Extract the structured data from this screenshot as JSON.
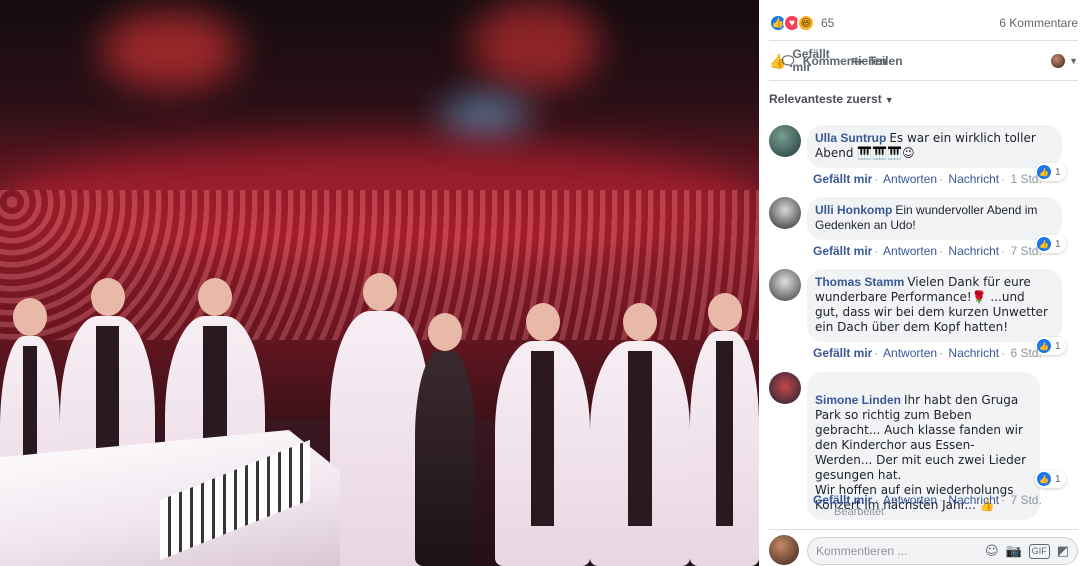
{
  "photo": {
    "alt_icon": "concert-photo"
  },
  "reactions": {
    "count": "65",
    "comments": "6 Kommentare",
    "colors": {
      "like": "#1877f2",
      "love": "#f33e58",
      "haha": "#f7b125"
    }
  },
  "actions": {
    "like": "Gefällt mir",
    "comment": "Kommentieren",
    "share": "Teilen"
  },
  "sort_label": "Relevanteste zuerst",
  "comments": [
    {
      "author": "Ulla Suntrup",
      "text": "Es war ein wirklich toller Abend 🎹🎹🎹😉",
      "likes": "1",
      "time": "1 Std."
    },
    {
      "author": "Ulli Honkomp",
      "text": "Ein wundervoller Abend im Gedenken an Udo!",
      "likes": "1",
      "time": "7 Std."
    },
    {
      "author": "Thomas Stamm",
      "text": "Vielen Dank für eure wunderbare Performance!🌹 ...und gut, dass wir bei dem kurzen Unwetter ein Dach über dem Kopf hatten!",
      "likes": "1",
      "time": "6 Std."
    },
    {
      "author": "Simone Linden",
      "text": "Ihr habt den Gruga Park so richtig zum Beben gebracht... Auch klasse fanden wir den Kinderchor aus Essen-Werden... Der mit euch zwei Lieder gesungen hat.\nWir hoffen auf ein wiederholungs Konzert im nächsten Jahr... 👍",
      "likes": "1",
      "time": "7 Std.",
      "edited": "Bearbeitet"
    }
  ],
  "comment_actions": {
    "like": "Gefällt mir",
    "reply": "Antworten",
    "message": "Nachricht"
  },
  "composer": {
    "placeholder": "Kommentieren ..."
  }
}
